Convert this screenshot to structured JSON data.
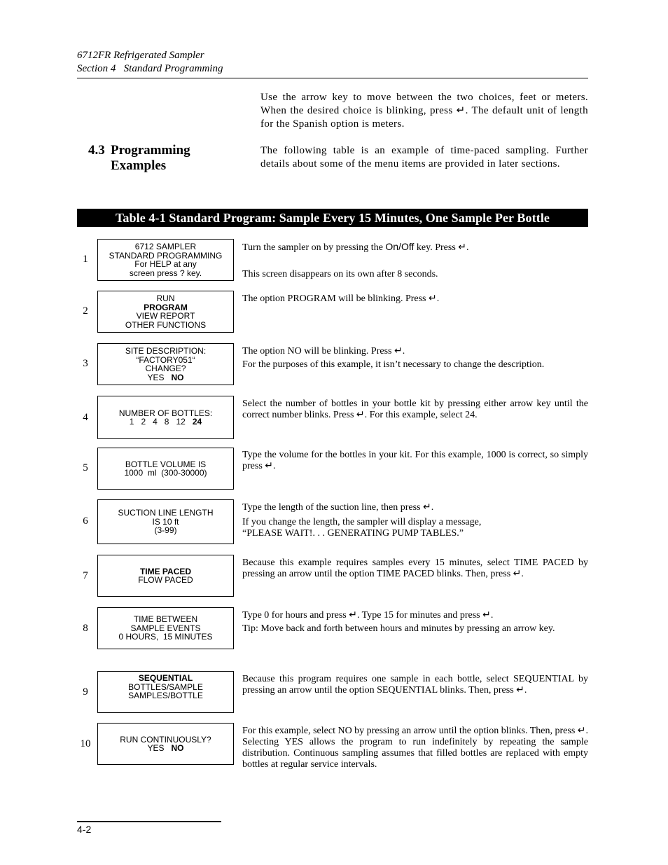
{
  "header": {
    "line1": "6712FR Refrigerated Sampler",
    "line2": "Section 4   Standard Programming"
  },
  "intro": {
    "paragraph1": "Use the arrow key to move between the two choices, feet or meters. When the desired choice is blinking, press ↵. The default unit of length for the Spanish option is meters.",
    "paragraph2": "The following table is an example of time-paced sampling. Further details about some of the menu items are provided in later sections."
  },
  "section": {
    "number": "4.3",
    "title_line1": "Programming",
    "title_line2": "Examples"
  },
  "table": {
    "title": "Table 4-1  Standard Program: Sample Every 15 Minutes, One Sample Per Bottle",
    "steps": [
      {
        "num": "1",
        "screen": [
          "6712 SAMPLER",
          "STANDARD PROGRAMMING",
          "For HELP at any",
          "screen press ? key."
        ],
        "desc_a_pre": "Turn the sampler on by pressing the ",
        "desc_a_key": "On/Off",
        "desc_a_post": " key. Press ↵.",
        "desc_b": "This screen disappears on its own after 8 seconds."
      },
      {
        "num": "2",
        "screen": [
          "RUN",
          "PROGRAM",
          "VIEW REPORT",
          "OTHER FUNCTIONS"
        ],
        "desc_a": "The option PROGRAM will be blinking. Press ↵."
      },
      {
        "num": "3",
        "screen": [
          "SITE DESCRIPTION:",
          "“FACTORY051“",
          "CHANGE?",
          "YES",
          "NO"
        ],
        "desc_a": "The option NO will be blinking. Press ↵.",
        "desc_b": "For the purposes of this example, it isn’t necessary to change the description."
      },
      {
        "num": "4",
        "screen": [
          "NUMBER OF BOTTLES:",
          "1   2   4   8   12",
          "24"
        ],
        "desc_a": "Select the number of bottles in your bottle kit by pressing either arrow key until the correct number blinks. Press ↵. For this example, select 24."
      },
      {
        "num": "5",
        "screen": [
          "BOTTLE VOLUME IS",
          "1000  ml  (300-30000)"
        ],
        "desc_a": "Type the volume for the bottles in your kit. For this example, 1000 is correct, so simply press ↵."
      },
      {
        "num": "6",
        "screen": [
          "SUCTION LINE LENGTH",
          "IS 10 ft",
          "(3-99)"
        ],
        "desc_a": "Type the length of the suction line, then press ↵.",
        "desc_b": "If you change the length, the sampler will display a message, “PLEASE WAIT!. . . GENERATING PUMP TABLES.”"
      },
      {
        "num": "7",
        "screen": [
          "TIME PACED",
          "FLOW PACED"
        ],
        "desc_a": "Because this example requires samples every 15 minutes, select TIME PACED by pressing an arrow until the option TIME PACED blinks. Then, press ↵."
      },
      {
        "num": "8",
        "screen": [
          "TIME BETWEEN",
          "SAMPLE EVENTS",
          "0 HOURS,  15 MINUTES"
        ],
        "desc_a": "Type 0 for hours and press ↵. Type 15 for minutes and press ↵.",
        "desc_b": "Tip: Move back and forth between hours and minutes by pressing an arrow key."
      },
      {
        "num": "9",
        "screen": [
          "SEQUENTIAL",
          "BOTTLES/SAMPLE",
          "SAMPLES/BOTTLE"
        ],
        "desc_a": "Because this program requires one sample in each bottle, select SEQUENTIAL by pressing an arrow until the option SEQUENTIAL blinks. Then, press ↵."
      },
      {
        "num": "10",
        "screen": [
          "RUN CONTINUOUSLY?",
          "YES",
          "NO"
        ],
        "desc_a": "For this example, select NO by pressing an arrow until the option blinks. Then, press ↵. Selecting YES allows the program to run indefinitely by repeating the sample distribution. Continuous sampling assumes that filled bottles are replaced with empty bottles at regular service intervals."
      }
    ]
  },
  "footer": {
    "page_number": "4-2"
  }
}
